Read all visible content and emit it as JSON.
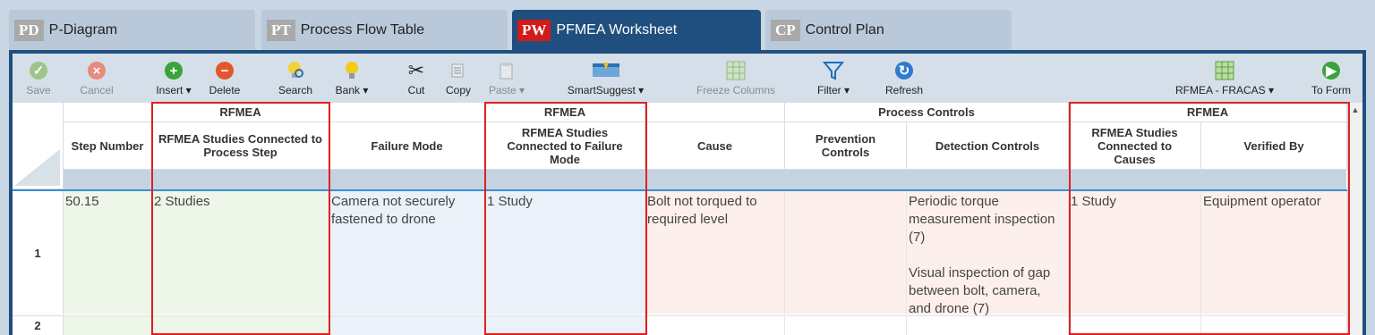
{
  "tabs": [
    {
      "badge": "PD",
      "label": "P-Diagram"
    },
    {
      "badge": "PT",
      "label": "Process Flow Table"
    },
    {
      "badge": "PW",
      "label": "PFMEA Worksheet"
    },
    {
      "badge": "CP",
      "label": "Control Plan"
    }
  ],
  "toolbar": {
    "save": "Save",
    "cancel": "Cancel",
    "insert": "Insert ▾",
    "delete": "Delete",
    "search": "Search",
    "bank": "Bank ▾",
    "cut": "Cut",
    "copy": "Copy",
    "paste": "Paste ▾",
    "smartsuggest": "SmartSuggest ▾",
    "freeze": "Freeze Columns",
    "filter": "Filter ▾",
    "refresh": "Refresh",
    "rfmea_fracas": "RFMEA - FRACAS ▾",
    "to_form": "To Form"
  },
  "groups": {
    "rfmea1": "RFMEA",
    "rfmea2": "RFMEA",
    "process_controls": "Process Controls",
    "rfmea3": "RFMEA"
  },
  "columns": {
    "step_number": "Step Number",
    "rfmea_process": "RFMEA Studies Connected to Process Step",
    "failure_mode": "Failure Mode",
    "rfmea_failure": "RFMEA Studies Connected to Failure Mode",
    "cause": "Cause",
    "prevention": "Prevention Controls",
    "detection": "Detection Controls",
    "rfmea_causes": "RFMEA Studies Connected to Causes",
    "verified_by": "Verified By"
  },
  "rows": [
    {
      "num": "1",
      "step_number": "50.15",
      "rfmea_process": "2 Studies",
      "failure_mode": "Camera not securely fastened to drone",
      "rfmea_failure": "1 Study",
      "cause": "Bolt not torqued to required level",
      "prevention": "",
      "detection_1": "Periodic torque measurement inspection (7)",
      "detection_2": "Visual inspection of gap between bolt, camera, and drone (7)",
      "rfmea_causes": "1 Study",
      "verified_by": "Equipment operator"
    },
    {
      "num": "2"
    }
  ],
  "colors": {
    "accent": "#1f4f7e",
    "highlight": "#e02020",
    "tab_active_badge": "#d11b1b"
  }
}
